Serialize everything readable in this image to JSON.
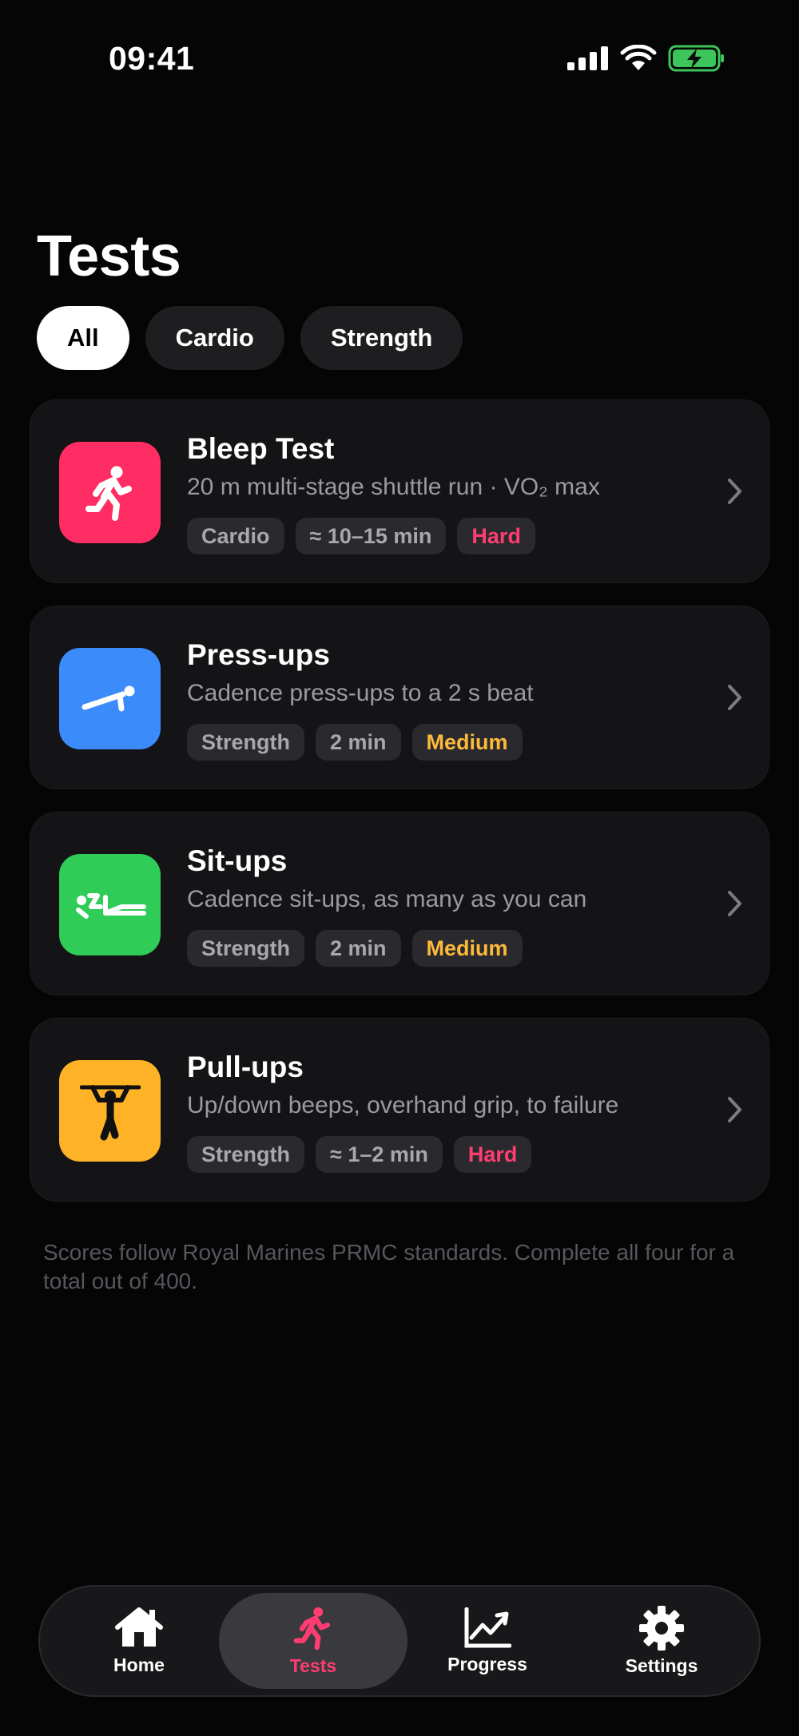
{
  "status_bar": {
    "time": "09:41"
  },
  "page": {
    "title": "Tests"
  },
  "filters": [
    {
      "label": "All",
      "active": true
    },
    {
      "label": "Cardio",
      "active": false
    },
    {
      "label": "Strength",
      "active": false
    }
  ],
  "tests": [
    {
      "title": "Bleep Test",
      "subtitle": "20 m multi-stage shuttle run · VO₂ max",
      "icon": "running-icon",
      "icon_color": "#ff2d63",
      "tags": [
        "Cardio",
        "≈ 10–15 min",
        "Hard"
      ]
    },
    {
      "title": "Press-ups",
      "subtitle": "Cadence press-ups to a 2 s beat",
      "icon": "press-up-icon",
      "icon_color": "#3b8bfb",
      "tags": [
        "Strength",
        "2 min",
        "Medium"
      ]
    },
    {
      "title": "Sit-ups",
      "subtitle": "Cadence sit-ups, as many as you can",
      "icon": "sit-up-icon",
      "icon_color": "#2fcc57",
      "tags": [
        "Strength",
        "2 min",
        "Medium"
      ]
    },
    {
      "title": "Pull-ups",
      "subtitle": "Up/down beeps, overhand grip, to failure",
      "icon": "pull-up-icon",
      "icon_color": "#feb327",
      "tags": [
        "Strength",
        "≈ 1–2 min",
        "Hard"
      ]
    }
  ],
  "difficulty_colors": {
    "Hard": "#ff3d72",
    "Medium": "#fcb93a"
  },
  "footnote": "Scores follow Royal Marines PRMC standards. Complete all four for a total out of 400.",
  "tabbar": {
    "items": [
      {
        "label": "Home",
        "icon": "home-icon",
        "active": false
      },
      {
        "label": "Tests",
        "icon": "running-icon",
        "active": true
      },
      {
        "label": "Progress",
        "icon": "chart-icon",
        "active": false
      },
      {
        "label": "Settings",
        "icon": "gear-icon",
        "active": false
      }
    ],
    "active_color": "#ff3d72"
  }
}
